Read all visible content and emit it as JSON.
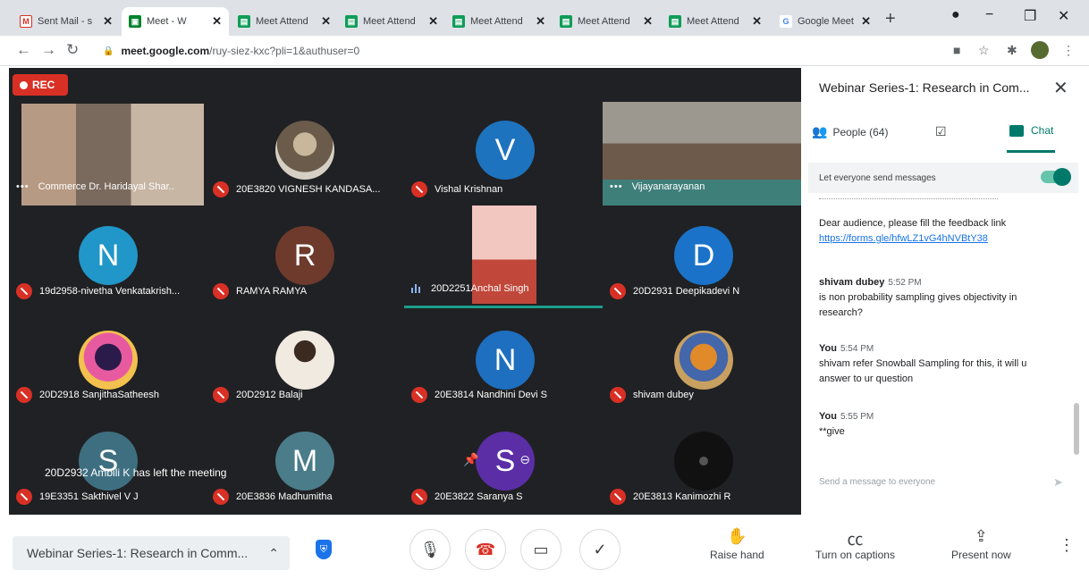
{
  "browser": {
    "tabs": [
      {
        "label": "Sent Mail - s",
        "fav": "M",
        "kind": "gmail"
      },
      {
        "label": "Meet - W",
        "fav": "▣",
        "kind": "meet",
        "active": true
      },
      {
        "label": "Meet Attend",
        "fav": "▤",
        "kind": "sheet"
      },
      {
        "label": "Meet Attend",
        "fav": "▤",
        "kind": "sheet"
      },
      {
        "label": "Meet Attend",
        "fav": "▤",
        "kind": "sheet"
      },
      {
        "label": "Meet Attend",
        "fav": "▤",
        "kind": "sheet"
      },
      {
        "label": "Meet Attend",
        "fav": "▤",
        "kind": "sheet"
      },
      {
        "label": "Google Meet",
        "fav": "G",
        "kind": "google"
      }
    ],
    "tab_close": "✕",
    "new_tab": "+",
    "url_host": "meet.google.com",
    "url_path": "/ruy-siez-kxc?pli=1&authuser=0"
  },
  "stage": {
    "rec_label": "REC",
    "toast": "20D2932 Ambili K has left the meeting",
    "tiles": [
      {
        "name": "Commerce Dr. Haridayal Shar..",
        "kind": "video",
        "muted": false,
        "more": true
      },
      {
        "name": "20E3820 VIGNESH KANDASA...",
        "kind": "photo",
        "muted": true
      },
      {
        "name": "Vishal Krishnan",
        "kind": "letter",
        "letter": "V",
        "color": "#1e73be",
        "muted": true
      },
      {
        "name": "Vijayanarayanan",
        "kind": "video",
        "muted": false,
        "more": true
      },
      {
        "name": "19d2958-nivetha Venkatakrish...",
        "kind": "letter",
        "letter": "N",
        "color": "#2196c8",
        "muted": true
      },
      {
        "name": "RAMYA RAMYA",
        "kind": "letter",
        "letter": "R",
        "color": "#6d3a2c",
        "muted": true
      },
      {
        "name": "20D2251Anchal Singh",
        "kind": "video",
        "muted": false,
        "speaking": true
      },
      {
        "name": "20D2931 Deepikadevi N",
        "kind": "letter",
        "letter": "D",
        "color": "#1a73c8",
        "muted": true
      },
      {
        "name": "20D2918 SanjithaSatheesh",
        "kind": "photo",
        "muted": true
      },
      {
        "name": "20D2912 Balaji",
        "kind": "photo",
        "muted": true
      },
      {
        "name": "20E3814 Nandhini Devi S",
        "kind": "letter",
        "letter": "N",
        "color": "#1e6fbf",
        "muted": true
      },
      {
        "name": "shivam dubey",
        "kind": "photo",
        "muted": true
      },
      {
        "name": "19E3351 Sakthivel V J",
        "kind": "letter",
        "letter": "S",
        "color": "#3e6f80",
        "muted": true
      },
      {
        "name": "20E3836 Madhumitha",
        "kind": "letter",
        "letter": "M",
        "color": "#4a7c8a",
        "muted": true
      },
      {
        "name": "20E3822 Saranya S",
        "kind": "letter",
        "letter": "S",
        "color": "#5b2ea6",
        "muted": true
      },
      {
        "name": "20E3813 Kanimozhi R",
        "kind": "photo",
        "muted": true
      }
    ]
  },
  "panel": {
    "title": "Webinar Series-1: Research in Com...",
    "close": "✕",
    "people_label": "People (64)",
    "chat_label": "Chat",
    "toggle_label": "Let everyone send messages",
    "messages": [
      {
        "sender": "",
        "time": "",
        "lines": [
          "Dear audience, please fill the feedback link"
        ],
        "link": "https://forms.gle/hfwLZ1vG4hNVBtY38"
      },
      {
        "sender": "shivam dubey",
        "time": "5:52 PM",
        "lines": [
          "is non probability sampling gives objectivity in",
          "research?"
        ]
      },
      {
        "sender": "You",
        "time": "5:54 PM",
        "lines": [
          "shivam refer Snowball Sampling for this, it will u",
          "answer to ur question"
        ]
      },
      {
        "sender": "You",
        "time": "5:55 PM",
        "lines": [
          "**give"
        ]
      }
    ],
    "compose_placeholder": "Send a message to everyone"
  },
  "bottom": {
    "meeting_title": "Webinar Series-1: Research in Comm...",
    "raise_hand": "Raise hand",
    "captions": "Turn on captions",
    "present": "Present now"
  }
}
